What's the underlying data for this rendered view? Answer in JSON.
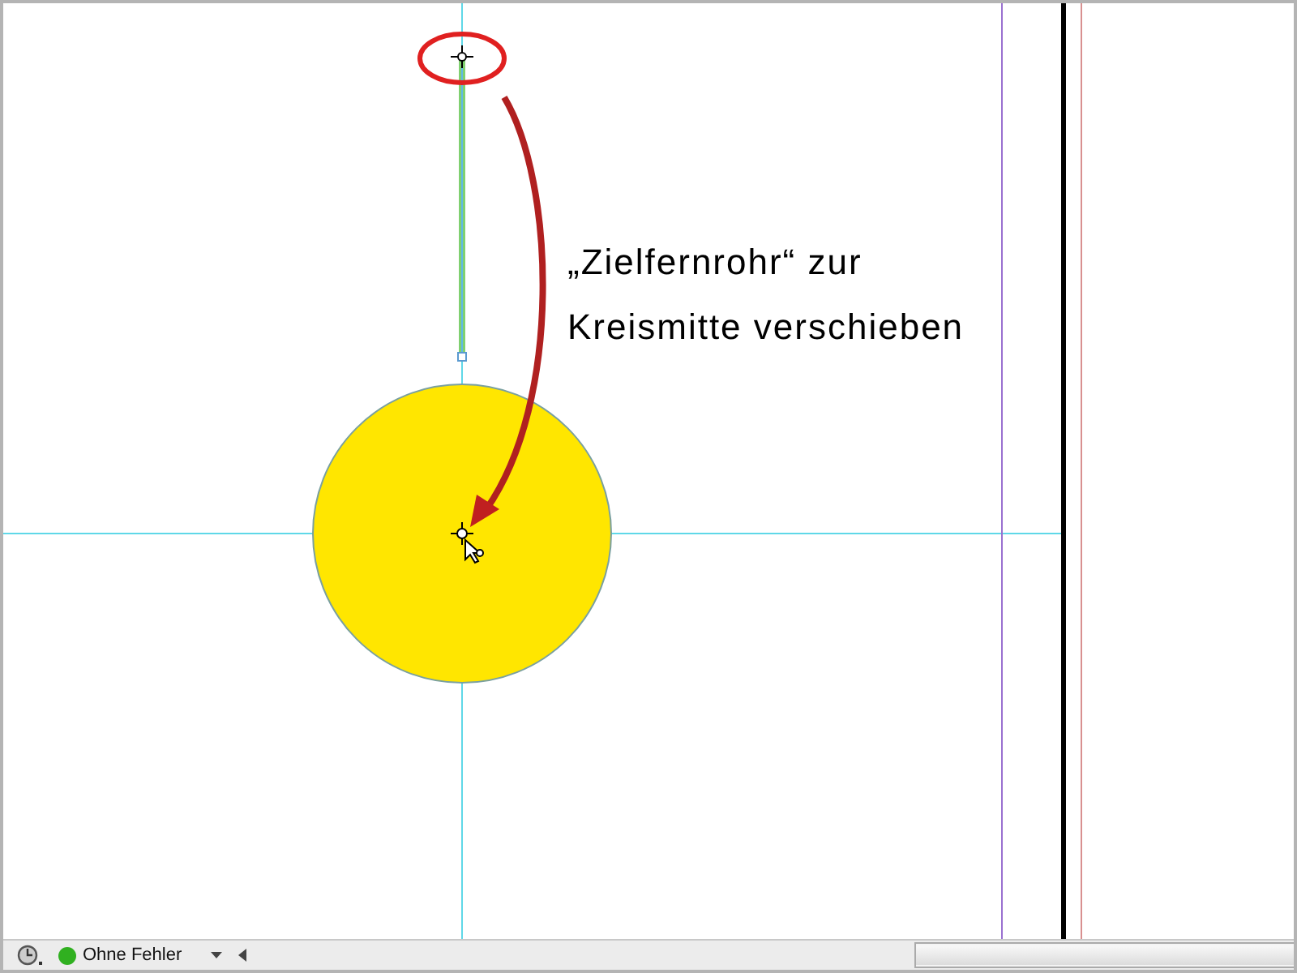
{
  "annotation": {
    "lines": [
      "„Zielfernrohr“ zur",
      "Kreismitte verschieben"
    ]
  },
  "status_bar": {
    "preflight": "Ohne Fehler"
  }
}
